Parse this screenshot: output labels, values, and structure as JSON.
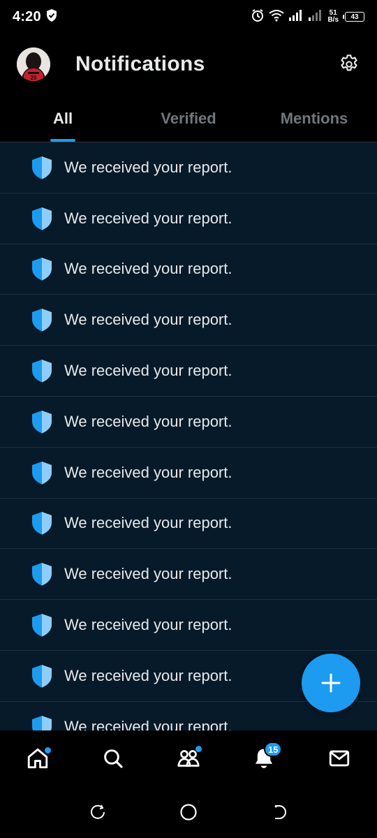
{
  "status_bar": {
    "time": "4:20",
    "net_speed_value": "51",
    "net_speed_unit": "B/s",
    "battery": "43"
  },
  "header": {
    "title": "Notifications",
    "avatar_icon": "user-avatar",
    "settings_icon": "gear-icon"
  },
  "tabs": [
    {
      "label": "All",
      "active": true
    },
    {
      "label": "Verified",
      "active": false
    },
    {
      "label": "Mentions",
      "active": false
    }
  ],
  "notifications": [
    {
      "icon": "shield-icon",
      "text": "We received your report."
    },
    {
      "icon": "shield-icon",
      "text": "We received your report."
    },
    {
      "icon": "shield-icon",
      "text": "We received your report."
    },
    {
      "icon": "shield-icon",
      "text": "We received your report."
    },
    {
      "icon": "shield-icon",
      "text": "We received your report."
    },
    {
      "icon": "shield-icon",
      "text": "We received your report."
    },
    {
      "icon": "shield-icon",
      "text": "We received your report."
    },
    {
      "icon": "shield-icon",
      "text": "We received your report."
    },
    {
      "icon": "shield-icon",
      "text": "We received your report."
    },
    {
      "icon": "shield-icon",
      "text": "We received your report."
    },
    {
      "icon": "shield-icon",
      "text": "We received your report."
    },
    {
      "icon": "shield-icon",
      "text": "We received your report."
    }
  ],
  "fab": {
    "icon": "plus-icon"
  },
  "bottom_nav": {
    "home": {
      "icon": "home-icon",
      "has_dot": true
    },
    "search": {
      "icon": "search-icon"
    },
    "communities": {
      "icon": "communities-icon",
      "has_dot": true
    },
    "notifications": {
      "icon": "bell-icon",
      "badge": "15"
    },
    "messages": {
      "icon": "mail-icon"
    }
  },
  "colors": {
    "accent": "#1d9bf0",
    "list_bg": "#071a2a",
    "text": "#e7e9ea",
    "muted": "#71767b"
  }
}
